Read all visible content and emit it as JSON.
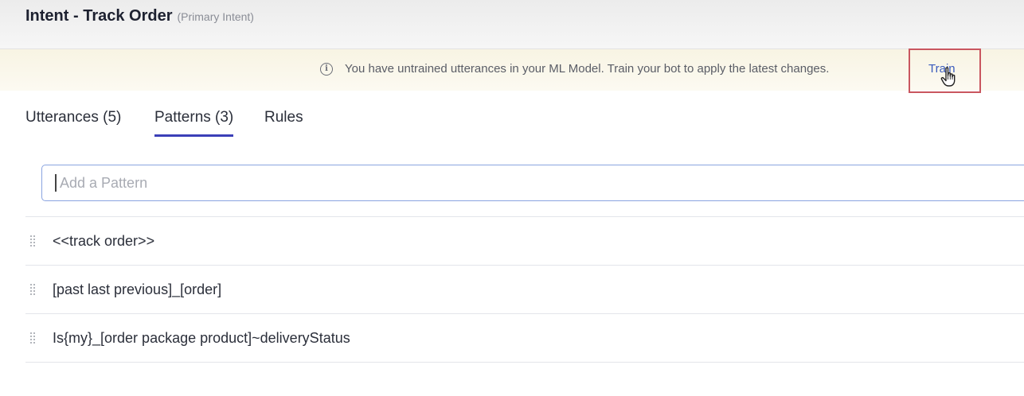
{
  "header": {
    "title": "Intent - Track Order",
    "subtitle": "(Primary Intent)"
  },
  "banner": {
    "icon": "info-icon",
    "message": "You have untrained utterances in your ML Model. Train your bot to apply the latest changes.",
    "action_label": "Train",
    "highlight_color": "#c9565f"
  },
  "tabs": [
    {
      "label": "Utterances (5)",
      "active": false
    },
    {
      "label": "Patterns (3)",
      "active": true
    },
    {
      "label": "Rules",
      "active": false
    }
  ],
  "pattern_input": {
    "placeholder": "Add a Pattern",
    "value": ""
  },
  "patterns": [
    {
      "text": "<<track order>>"
    },
    {
      "text": "[past last previous]_[order]"
    },
    {
      "text": "Is{my}_[order package product]~deliveryStatus"
    }
  ],
  "colors": {
    "accent": "#3b3fb8",
    "link": "#3a5bbd",
    "banner_bg": "#f8f4e3"
  }
}
